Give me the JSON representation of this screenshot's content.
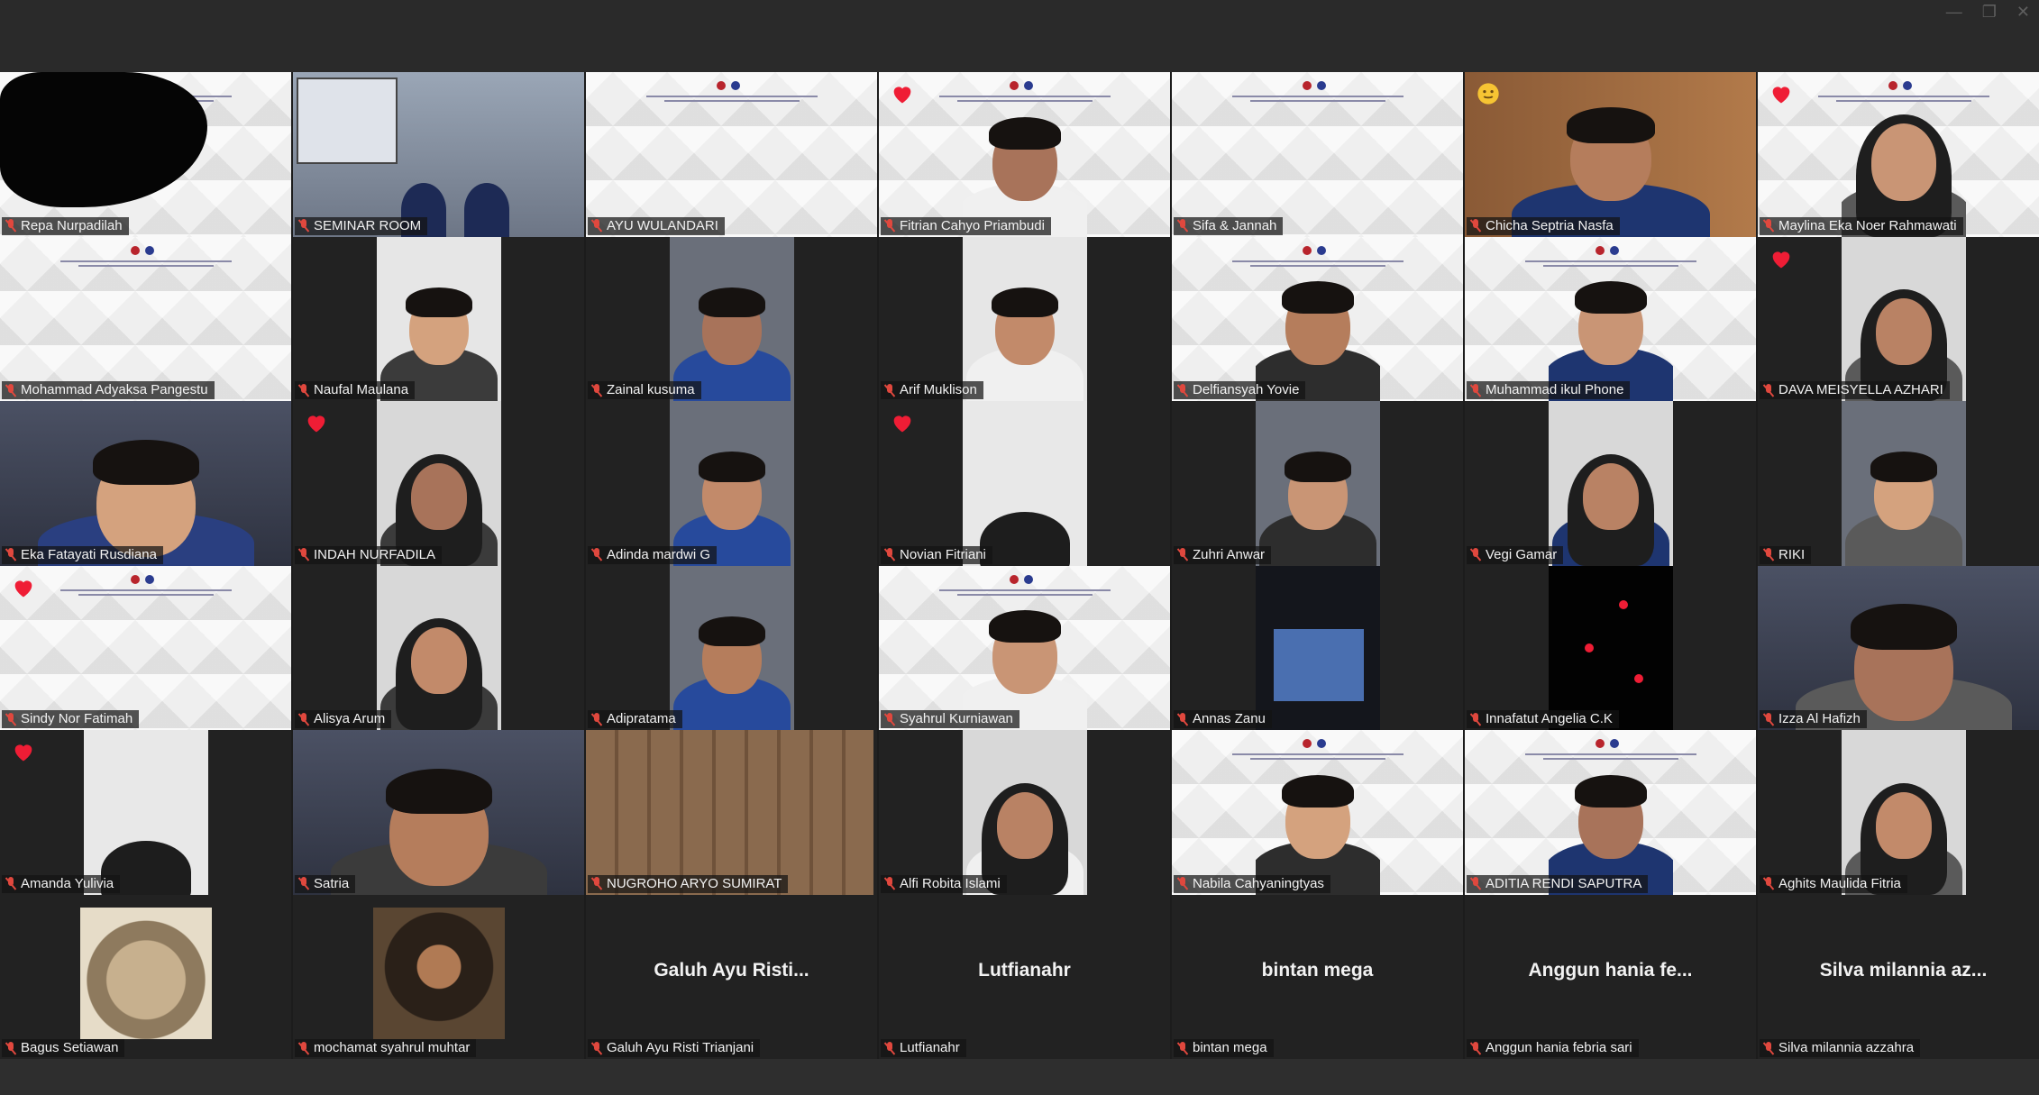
{
  "window": {
    "controls": [
      "—",
      "❐",
      "✕"
    ]
  },
  "participants": [
    {
      "name": "Repa Nurpadilah",
      "kind": "poster-censored"
    },
    {
      "name": "SEMINAR ROOM",
      "kind": "room",
      "active": true
    },
    {
      "name": "AYU WULANDARI",
      "kind": "poster"
    },
    {
      "name": "Fitrian Cahyo Priambudi",
      "kind": "poster-person",
      "reaction": "heart-icon"
    },
    {
      "name": "Sifa & Jannah",
      "kind": "poster"
    },
    {
      "name": "Chicha Septria Nasfa",
      "kind": "room-person",
      "reaction": "smile-emoji-icon"
    },
    {
      "name": "Maylina Eka Noer Rahmawati",
      "kind": "poster-hijab",
      "reaction": "heart-icon"
    },
    {
      "name": "Mohammad Adyaksa Pangestu",
      "kind": "poster"
    },
    {
      "name": "Naufal Maulana",
      "kind": "narrow-poster-person"
    },
    {
      "name": "Zainal kusuma",
      "kind": "narrow-person"
    },
    {
      "name": "Arif Muklison",
      "kind": "narrow-poster-person"
    },
    {
      "name": "Delfiansyah Yovie",
      "kind": "poster-person"
    },
    {
      "name": "Muhammad ikul Phone",
      "kind": "poster-person"
    },
    {
      "name": "DAVA MEISYELLA AZHARI",
      "kind": "narrow-hijab",
      "reaction": "heart-icon"
    },
    {
      "name": "Eka Fatayati Rusdiana",
      "kind": "full-person"
    },
    {
      "name": "INDAH NURFADILA",
      "kind": "narrow-hijab",
      "reaction": "heart-icon"
    },
    {
      "name": "Adinda mardwi G",
      "kind": "narrow-person"
    },
    {
      "name": "Novian Fitriani",
      "kind": "narrow-light",
      "reaction": "heart-icon"
    },
    {
      "name": "Zuhri Anwar",
      "kind": "narrow-person"
    },
    {
      "name": "Vegi Gamar",
      "kind": "narrow-hijab"
    },
    {
      "name": "RIKI",
      "kind": "narrow-person"
    },
    {
      "name": "Sindy Nor Fatimah",
      "kind": "poster",
      "reaction": "heart-icon"
    },
    {
      "name": "Alisya Arum",
      "kind": "narrow-hijab"
    },
    {
      "name": "Adipratama",
      "kind": "narrow-person"
    },
    {
      "name": "Syahrul Kurniawan",
      "kind": "poster-person"
    },
    {
      "name": "Annas Zanu",
      "kind": "narrow-dark"
    },
    {
      "name": "Innafatut Angelia C.K",
      "kind": "narrow-black"
    },
    {
      "name": "Izza Al Hafizh",
      "kind": "full-person"
    },
    {
      "name": "Amanda Yulivia",
      "kind": "narrow-light",
      "reaction": "heart-icon"
    },
    {
      "name": "Satria",
      "kind": "full-person"
    },
    {
      "name": "NUGROHO ARYO SUMIRAT",
      "kind": "wood"
    },
    {
      "name": "Alfi Robita Islami",
      "kind": "narrow-hijab"
    },
    {
      "name": "Nabila Cahyaningtyas",
      "kind": "poster-person"
    },
    {
      "name": "ADITIA RENDI SAPUTRA",
      "kind": "poster-person"
    },
    {
      "name": "Aghits Maulida Fitria",
      "kind": "narrow-hijab"
    },
    {
      "name": "Bagus Setiawan",
      "kind": "cat-avatar"
    },
    {
      "name": "mochamat syahrul muhtar",
      "kind": "photo-avatar"
    },
    {
      "name": "Galuh Ayu Risti Trianjani",
      "kind": "noVideo",
      "display": "Galuh Ayu Risti..."
    },
    {
      "name": "Lutfianahr",
      "kind": "noVideo",
      "display": "Lutfianahr"
    },
    {
      "name": "bintan mega",
      "kind": "noVideo",
      "display": "bintan mega"
    },
    {
      "name": "Anggun hania febria sari",
      "kind": "noVideo",
      "display": "Anggun hania fe..."
    },
    {
      "name": "Silva milannia azzahra",
      "kind": "noVideo",
      "display": "Silva milannia az..."
    }
  ],
  "colors": {
    "background": "#232323",
    "active_speaker": "#33c06a",
    "muted_mic": "#e0483e",
    "heart": "#ef1d35"
  }
}
